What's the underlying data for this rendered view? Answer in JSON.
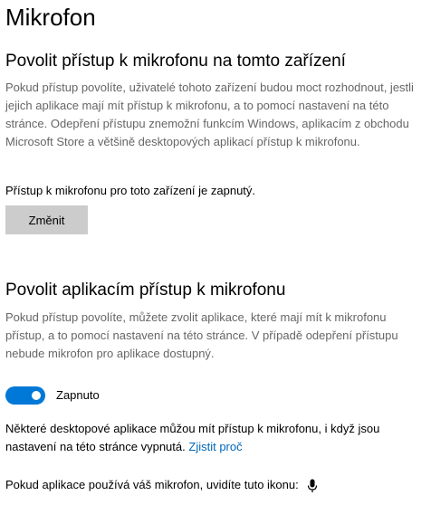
{
  "page": {
    "title": "Mikrofon"
  },
  "device_access": {
    "heading": "Povolit přístup k mikrofonu na tomto zařízení",
    "description": "Pokud přístup povolíte, uživatelé tohoto zařízení budou moct rozhodnout, jestli jejich aplikace mají mít přístup k mikrofonu, a to pomocí nastavení na této stránce. Odepření přístupu znemožní funkcím Windows, aplikacím z obchodu Microsoft Store a většině desktopových aplikací přístup k mikrofonu.",
    "status": "Přístup k mikrofonu pro toto zařízení je zapnutý.",
    "change_button": "Změnit"
  },
  "app_access": {
    "heading": "Povolit aplikacím přístup k mikrofonu",
    "description": "Pokud přístup povolíte, můžete zvolit aplikace, které mají mít k mikrofonu přístup, a to pomocí nastavení na této stránce. V případě odepření přístupu nebude mikrofon pro aplikace dostupný.",
    "toggle_state": "Zapnuto",
    "toggle_on": true
  },
  "desktop_note": {
    "text": "Některé desktopové aplikace můžou mít přístup k mikrofonu, i když jsou nastavení na této stránce vypnutá.",
    "link": "Zjistit proč"
  },
  "icon_note": {
    "text": "Pokud aplikace používá váš mikrofon, uvidíte tuto ikonu:",
    "icon": "microphone-icon"
  },
  "colors": {
    "accent": "#0078d7",
    "link": "#0067b8",
    "button_bg": "#cccccc",
    "description_text": "#666666"
  }
}
